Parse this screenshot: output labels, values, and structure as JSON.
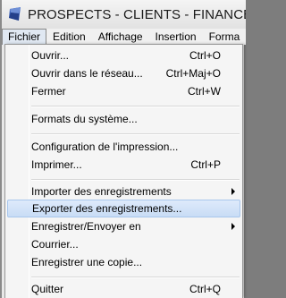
{
  "window": {
    "title": "PROSPECTS - CLIENTS - FINANCEURS"
  },
  "menubar": {
    "items": [
      {
        "label": "Fichier"
      },
      {
        "label": "Edition"
      },
      {
        "label": "Affichage"
      },
      {
        "label": "Insertion"
      },
      {
        "label": "Forma"
      }
    ]
  },
  "menu": {
    "items": [
      {
        "label": "Ouvrir...",
        "shortcut": "Ctrl+O"
      },
      {
        "label": "Ouvrir dans le réseau...",
        "shortcut": "Ctrl+Maj+O"
      },
      {
        "label": "Fermer",
        "shortcut": "Ctrl+W"
      },
      {
        "label": "Formats du système...",
        "shortcut": ""
      },
      {
        "label": "Configuration de l'impression...",
        "shortcut": ""
      },
      {
        "label": "Imprimer...",
        "shortcut": "Ctrl+P"
      },
      {
        "label": "Importer des enregistrements",
        "shortcut": ""
      },
      {
        "label": "Exporter des enregistrements...",
        "shortcut": ""
      },
      {
        "label": "Enregistrer/Envoyer en",
        "shortcut": ""
      },
      {
        "label": "Courrier...",
        "shortcut": ""
      },
      {
        "label": "Enregistrer une copie...",
        "shortcut": ""
      },
      {
        "label": "Quitter",
        "shortcut": "Ctrl+Q"
      }
    ],
    "highlighted_item": "Exporter des enregistrements..."
  },
  "colors": {
    "highlight": "#c8dcf5",
    "menu_bg": "#f5f5f5",
    "app_icon": "#3a5fb8"
  },
  "icons": {
    "app": "app-logo-icon",
    "submenu": "submenu-arrow-icon"
  }
}
